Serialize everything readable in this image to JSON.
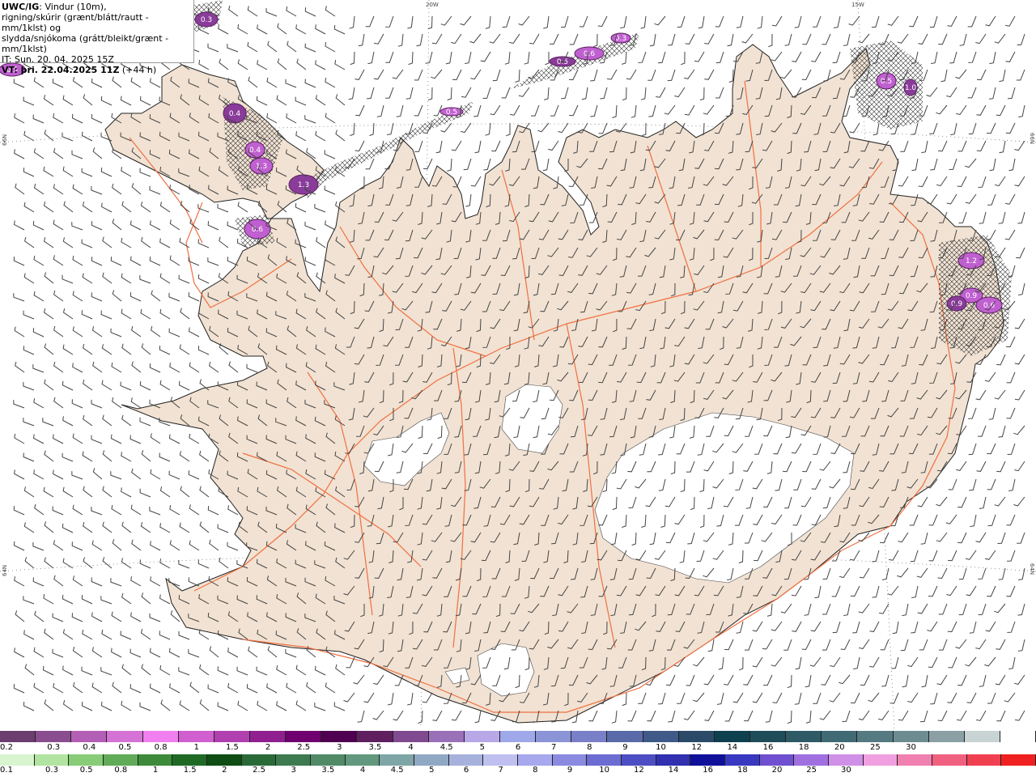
{
  "info": {
    "line1_bold": "UWC/IG",
    "line1_rest": ": Vindur (10m),",
    "line2": "rigning/skúrir (grænt/blátt/rautt - mm/1klst) og",
    "line3": "slydda/snjókoma (grátt/bleikt/grænt - mm/1klst)",
    "line4": "IT: Sun. 20. 04. 2025 15Z",
    "line5_bold": "VT: þri. 22.04.2025 11Z",
    "line5_rest": " (+44 h)"
  },
  "grid_labels": {
    "top": [
      "20W",
      "15W"
    ],
    "left": [
      "66N",
      "64N"
    ],
    "right": [
      "66N",
      "64N"
    ]
  },
  "map_colors": {
    "land": "#f1e2d3",
    "glacier": "#ffffff",
    "road": "#f07040",
    "barb": "#444444",
    "sea": "#ffffff"
  },
  "precip_cells": [
    {
      "label": "0.3"
    },
    {
      "label": "0.5"
    },
    {
      "label": "0.6"
    },
    {
      "label": "0.5"
    },
    {
      "label": "0.3"
    },
    {
      "label": "0.5"
    },
    {
      "label": "0.4"
    },
    {
      "label": "0.4"
    },
    {
      "label": "1.3"
    },
    {
      "label": "1.3"
    },
    {
      "label": "0.6"
    },
    {
      "label": "0.5"
    },
    {
      "label": "1.0"
    },
    {
      "label": "1.2"
    },
    {
      "label": "0.9"
    },
    {
      "label": "0.9"
    },
    {
      "label": "0.6"
    }
  ],
  "colorbar_top": {
    "colors": [
      "#6b3e6f",
      "#8a4d8f",
      "#b35fb5",
      "#d472d6",
      "#f080f0",
      "#d060d0",
      "#b040b0",
      "#902090",
      "#700070",
      "#500050",
      "#602060",
      "#804a90",
      "#9a70b8",
      "#b8a8e8",
      "#9fa8e8",
      "#8c94d8",
      "#7a80c8",
      "#5a6aa8",
      "#3f5a88",
      "#2a4a68",
      "#0e4050",
      "#1e4c58",
      "#2e5a66",
      "#406a74",
      "#567a82",
      "#6c8c92",
      "#8aa0a4",
      "#c8d4d4",
      "#ffffff"
    ],
    "ticks": [
      "0.2",
      "0.3",
      "0.4",
      "0.5",
      "0.8",
      "1",
      "1.5",
      "2",
      "2.5",
      "3",
      "3.5",
      "4",
      "4.5",
      "5",
      "6",
      "7",
      "8",
      "9",
      "10",
      "12",
      "14",
      "16",
      "18",
      "20",
      "25",
      "30"
    ]
  },
  "colorbar_bottom": {
    "colors": [
      "#d8f5d0",
      "#b0e4a0",
      "#88cc78",
      "#60aa58",
      "#3d8a3a",
      "#1e6a24",
      "#0e4e14",
      "#2a6a38",
      "#3e7a50",
      "#508a66",
      "#62987e",
      "#7ea6a6",
      "#90a8c4",
      "#a6b2dc",
      "#c0c0f0",
      "#a8a8ee",
      "#8a8ae0",
      "#6c6cd2",
      "#4e4ec4",
      "#3030b0",
      "#10109a",
      "#3838c0",
      "#7050d0",
      "#a070e0",
      "#d090e8",
      "#f0a0e0",
      "#f080b0",
      "#f06080",
      "#f04050",
      "#f02020"
    ],
    "ticks": [
      "0.1",
      "0.3",
      "0.5",
      "0.8",
      "1",
      "1.5",
      "2",
      "2.5",
      "3",
      "3.5",
      "4",
      "4.5",
      "5",
      "6",
      "7",
      "8",
      "9",
      "10",
      "12",
      "14",
      "16",
      "18",
      "20",
      "25",
      "30"
    ]
  }
}
